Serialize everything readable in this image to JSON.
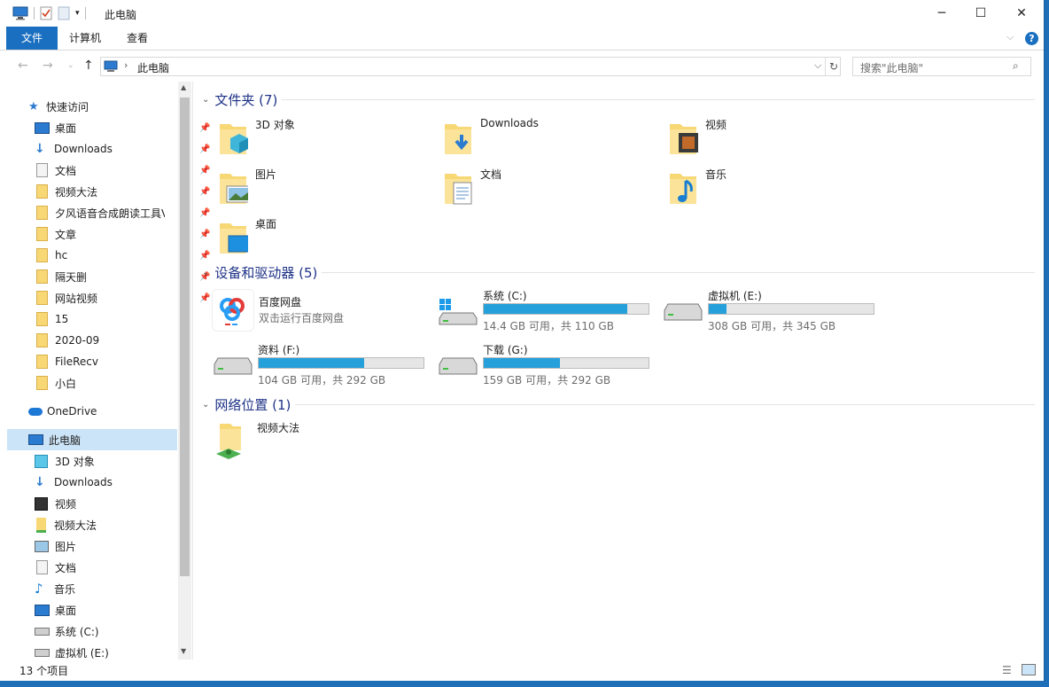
{
  "window": {
    "title": "此电脑"
  },
  "ribbon": {
    "tabs": [
      "文件",
      "计算机",
      "查看"
    ]
  },
  "address": {
    "path": "此电脑",
    "search_placeholder": "搜索\"此电脑\""
  },
  "nav": {
    "quick_access": "快速访问",
    "pinned": [
      "桌面",
      "Downloads",
      "文档",
      "视频大法",
      "夕风语音合成朗读工具V",
      "文章",
      "hc",
      "隔天删",
      "网站视频"
    ],
    "recent": [
      "15",
      "2020-09",
      "FileRecv",
      "小白"
    ],
    "onedrive": "OneDrive",
    "this_pc": "此电脑",
    "pc_items": [
      "3D 对象",
      "Downloads",
      "视频",
      "视频大法",
      "图片",
      "文档",
      "音乐",
      "桌面",
      "系统 (C:)",
      "虚拟机 (E:)"
    ]
  },
  "groups": {
    "folders": "文件夹 (7)",
    "devices": "设备和驱动器 (5)",
    "network": "网络位置 (1)"
  },
  "folders": [
    "3D 对象",
    "Downloads",
    "视频",
    "图片",
    "文档",
    "音乐",
    "桌面"
  ],
  "baidu": {
    "name": "百度网盘",
    "sub": "双击运行百度网盘"
  },
  "drives": [
    {
      "name": "系统 (C:)",
      "free": "14.4 GB 可用，共 110 GB",
      "used_fraction": 0.87
    },
    {
      "name": "虚拟机 (E:)",
      "free": "308 GB 可用，共 345 GB",
      "used_fraction": 0.11
    },
    {
      "name": "资料 (F:)",
      "free": "104 GB 可用，共 292 GB",
      "used_fraction": 0.64
    },
    {
      "name": "下载 (G:)",
      "free": "159 GB 可用，共 292 GB",
      "used_fraction": 0.46
    }
  ],
  "network": [
    "视频大法"
  ],
  "status": {
    "count": "13 个项目"
  },
  "colors": {
    "accent": "#1a6fc0",
    "bar_fill": "#26a0da",
    "group_text": "#1e3287",
    "folder": "#f8d775"
  }
}
